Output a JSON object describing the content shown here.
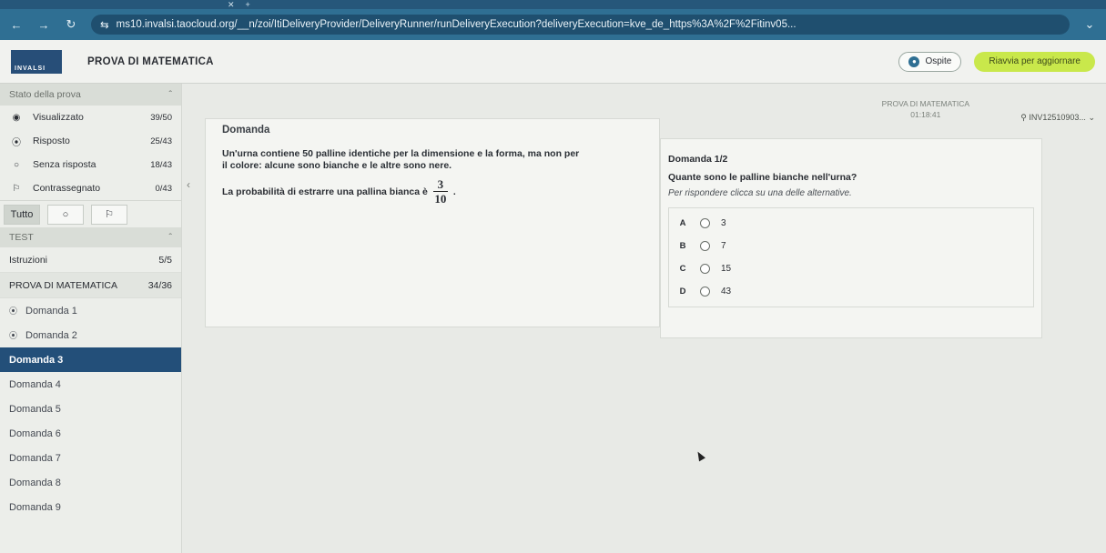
{
  "browser": {
    "url": "ms10.invalsi.taocloud.org/__n/zoi/ItiDeliveryProvider/DeliveryRunner/runDeliveryExecution?deliveryExecution=kve_de_https%3A%2F%2Fitinv05..."
  },
  "app": {
    "logo_text": "INVALSI",
    "title": "PROVA DI MATEMATICA",
    "guest_label": "Ospite",
    "update_label": "Riavvia per aggiornare"
  },
  "sidebar": {
    "state_header": "Stato della prova",
    "stats": [
      {
        "icon": "eye-icon",
        "label": "Visualizzato",
        "count": "39/50"
      },
      {
        "icon": "dot-radio-icon",
        "label": "Risposto",
        "count": "25/43"
      },
      {
        "icon": "empty-radio-icon",
        "label": "Senza risposta",
        "count": "18/43"
      },
      {
        "icon": "flag-icon",
        "label": "Contrassegnato",
        "count": "0/43"
      }
    ],
    "filter_all": "Tutto",
    "test_header": "TEST",
    "sections": [
      {
        "label": "Istruzioni",
        "count": "5/5"
      },
      {
        "label": "PROVA DI MATEMATICA",
        "count": "34/36"
      }
    ],
    "items": [
      {
        "label": "Domanda 1"
      },
      {
        "label": "Domanda 2"
      },
      {
        "label": "Domanda 3"
      },
      {
        "label": "Domanda 4"
      },
      {
        "label": "Domanda 5"
      },
      {
        "label": "Domanda 6"
      },
      {
        "label": "Domanda 7"
      },
      {
        "label": "Domanda 8"
      },
      {
        "label": "Domanda 9"
      }
    ],
    "active_index": 2
  },
  "meta": {
    "section_label": "PROVA DI MATEMATICA",
    "timer": "01:18:41",
    "user_id": "INV12510903..."
  },
  "question": {
    "header": "Domanda",
    "stem_line1": "Un'urna contiene 50 palline identiche per la dimensione e la forma, ma non per",
    "stem_line2": "il colore: alcune sono bianche e le altre sono nere.",
    "prob_text": "La probabilità di estrarre una pallina bianca è",
    "frac_num": "3",
    "frac_den": "10",
    "prob_end": "."
  },
  "interaction": {
    "number": "Domanda 1/2",
    "prompt": "Quante sono le palline bianche nell'urna?",
    "instruction": "Per rispondere clicca su una delle alternative.",
    "choices": [
      {
        "letter": "A",
        "value": "3"
      },
      {
        "letter": "B",
        "value": "7"
      },
      {
        "letter": "C",
        "value": "15"
      },
      {
        "letter": "D",
        "value": "43"
      }
    ]
  }
}
